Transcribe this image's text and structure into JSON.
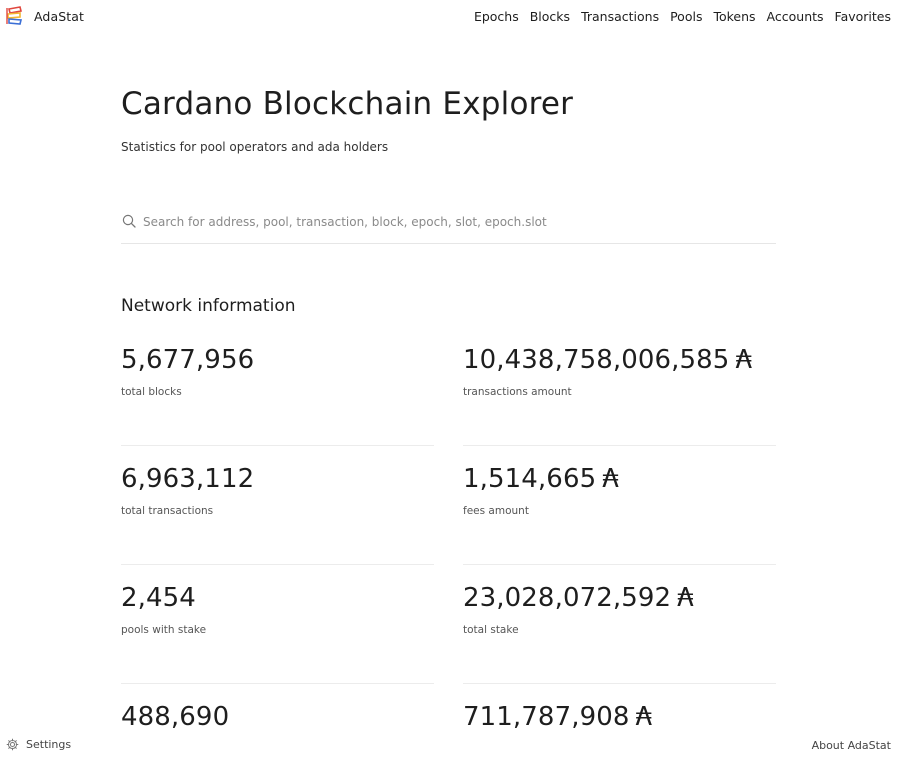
{
  "brand": {
    "name": "AdaStat",
    "logo_icon": "adastat-logo-icon"
  },
  "nav": {
    "items": [
      {
        "label": "Epochs"
      },
      {
        "label": "Blocks"
      },
      {
        "label": "Transactions"
      },
      {
        "label": "Pools"
      },
      {
        "label": "Tokens"
      },
      {
        "label": "Accounts"
      },
      {
        "label": "Favorites"
      }
    ]
  },
  "hero": {
    "title": "Cardano Blockchain Explorer",
    "subtitle": "Statistics for pool operators and ada holders"
  },
  "search": {
    "icon": "search-icon",
    "placeholder": "Search for address, pool, transaction, block, epoch, slot, epoch.slot",
    "value": ""
  },
  "network": {
    "title": "Network information",
    "stats": [
      {
        "value": "5,677,956",
        "label": "total blocks",
        "ada": ""
      },
      {
        "value": "10,438,758,006,585",
        "label": "transactions amount",
        "ada": "₳"
      },
      {
        "value": "6,963,112",
        "label": "total transactions",
        "ada": ""
      },
      {
        "value": "1,514,665",
        "label": "fees amount",
        "ada": "₳"
      },
      {
        "value": "2,454",
        "label": "pools with stake",
        "ada": ""
      },
      {
        "value": "23,028,072,592",
        "label": "total stake",
        "ada": "₳"
      },
      {
        "value": "488,690",
        "label": "",
        "ada": ""
      },
      {
        "value": "711,787,908",
        "label": "",
        "ada": "₳"
      }
    ]
  },
  "footer": {
    "settings_label": "Settings",
    "settings_icon": "gear-icon",
    "about_label": "About AdaStat"
  },
  "colors": {
    "text": "#1e1e1e",
    "muted": "#555555",
    "divider": "#ececec",
    "logo_red": "#e0473e",
    "logo_yellow": "#f2b632",
    "logo_blue": "#3b6fd6"
  }
}
